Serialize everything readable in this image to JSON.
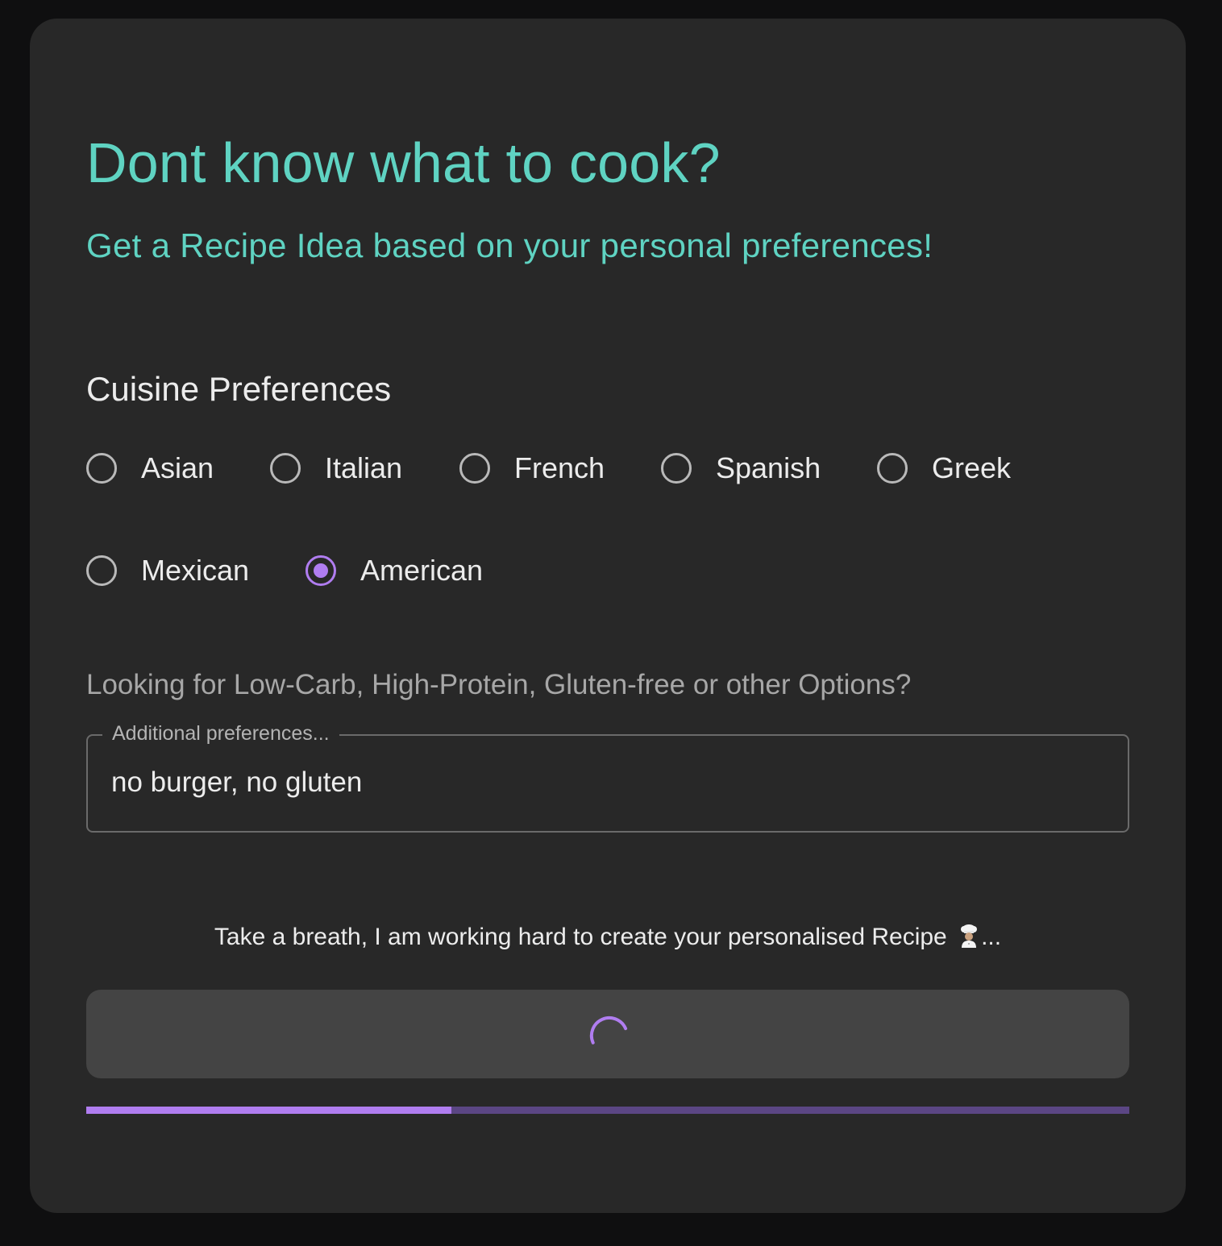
{
  "colors": {
    "accent": "#b07df0",
    "heading": "#5fd3c2",
    "background": "#0f0f10",
    "card": "#282828"
  },
  "header": {
    "title": "Dont know what to cook?",
    "subtitle": "Get a Recipe Idea based on your personal preferences!"
  },
  "cuisine": {
    "title": "Cuisine Preferences",
    "selected": "American",
    "options": [
      {
        "label": "Asian",
        "checked": false
      },
      {
        "label": "Italian",
        "checked": false
      },
      {
        "label": "French",
        "checked": false
      },
      {
        "label": "Spanish",
        "checked": false
      },
      {
        "label": "Greek",
        "checked": false
      },
      {
        "label": "Mexican",
        "checked": false
      },
      {
        "label": "American",
        "checked": true
      }
    ]
  },
  "preferences": {
    "hint": "Looking for Low-Carb, High-Protein, Gluten-free or other Options?",
    "label": "Additional preferences...",
    "value": "no burger, no gluten"
  },
  "status": {
    "text": "Take a breath, I am working hard to create your personalised Recipe",
    "icon": "chef-icon",
    "suffix": "..."
  },
  "generate_button": {
    "state": "loading",
    "icon": "loading-spinner-icon"
  },
  "progress": {
    "value": 0.35
  }
}
